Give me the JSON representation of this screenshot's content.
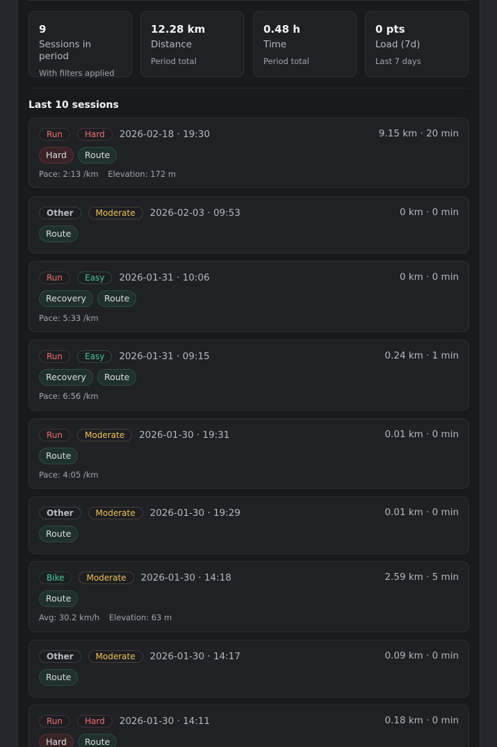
{
  "stats": [
    {
      "value": "9",
      "label": "Sessions in period",
      "sub": "With filters applied"
    },
    {
      "value": "12.28 km",
      "label": "Distance",
      "sub": "Period total"
    },
    {
      "value": "0.48 h",
      "label": "Time",
      "sub": "Period total"
    },
    {
      "value": "0 pts",
      "label": "Load (7d)",
      "sub": "Last 7 days"
    }
  ],
  "section_title": "Last 10 sessions",
  "sessions": [
    {
      "sport": "Run",
      "intensity": "Hard",
      "datetime": "2026-02-18 · 19:30",
      "summary": "9.15 km · 20 min",
      "tags": [
        "Hard",
        "Route"
      ],
      "meta": [
        "Pace: 2:13 /km",
        "Elevation: 172 m"
      ]
    },
    {
      "sport": "Other",
      "intensity": "Moderate",
      "datetime": "2026-02-03 · 09:53",
      "summary": "0 km · 0 min",
      "tags": [
        "Route"
      ],
      "meta": []
    },
    {
      "sport": "Run",
      "intensity": "Easy",
      "datetime": "2026-01-31 · 10:06",
      "summary": "0 km · 0 min",
      "tags": [
        "Recovery",
        "Route"
      ],
      "meta": [
        "Pace: 5:33 /km"
      ]
    },
    {
      "sport": "Run",
      "intensity": "Easy",
      "datetime": "2026-01-31 · 09:15",
      "summary": "0.24 km · 1 min",
      "tags": [
        "Recovery",
        "Route"
      ],
      "meta": [
        "Pace: 6:56 /km"
      ]
    },
    {
      "sport": "Run",
      "intensity": "Moderate",
      "datetime": "2026-01-30 · 19:31",
      "summary": "0.01 km · 0 min",
      "tags": [
        "Route"
      ],
      "meta": [
        "Pace: 4:05 /km"
      ]
    },
    {
      "sport": "Other",
      "intensity": "Moderate",
      "datetime": "2026-01-30 · 19:29",
      "summary": "0.01 km · 0 min",
      "tags": [
        "Route"
      ],
      "meta": []
    },
    {
      "sport": "Bike",
      "intensity": "Moderate",
      "datetime": "2026-01-30 · 14:18",
      "summary": "2.59 km · 5 min",
      "tags": [
        "Route"
      ],
      "meta": [
        "Avg: 30.2 km/h",
        "Elevation: 63 m"
      ]
    },
    {
      "sport": "Other",
      "intensity": "Moderate",
      "datetime": "2026-01-30 · 14:17",
      "summary": "0.09 km · 0 min",
      "tags": [
        "Route"
      ],
      "meta": []
    },
    {
      "sport": "Run",
      "intensity": "Hard",
      "datetime": "2026-01-30 · 14:11",
      "summary": "0.18 km · 0 min",
      "tags": [
        "Hard",
        "Route"
      ],
      "meta": []
    }
  ]
}
